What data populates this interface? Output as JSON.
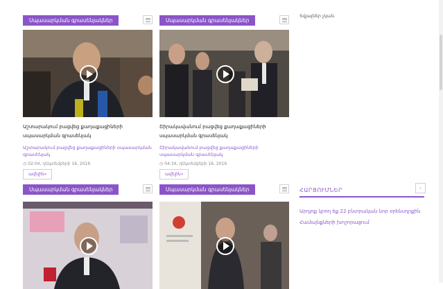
{
  "cards": [
    {
      "category": "Սպասարկման գրասենյակներ",
      "title": "Աշտարակում բացվեց քաղաքացիների սպասարկման գրասենյակ",
      "description": "Աշտարակում բացվեց քաղաքացիների սպասարկման գրասենյակ",
      "time": "02:04",
      "date": "դեկտեմբերի 16, 2016",
      "more": "ավելին"
    },
    {
      "category": "Սպասարկման գրասենյակներ",
      "title": "Շիրակավանում բացվեց քաղաքացիների սպասարկման գրասենյակ",
      "description": "Շիրակավանում բացվեց քաղաքացիների սպասարկման գրասենյակ",
      "time": "04:34",
      "date": "դեկտեմբերի 16, 2016",
      "more": "ավելին"
    },
    {
      "category": "Սպասարկման գրասենյակներ"
    },
    {
      "category": "Սպասարկման գրասենյակներ"
    }
  ],
  "sidebar": {
    "empty_text": "Տվյալներ չկան",
    "announcements_title": "ՀԱՐՑՈՒՄՆԵՐ",
    "announcements": [
      "Արդյոք կրող եք 22 բնտրական նոր օրենսդրքին",
      "Համայնքների խոշորացում"
    ]
  },
  "colors": {
    "accent": "#8b55c8"
  },
  "icons": {
    "menu": "list-icon",
    "play": "play-icon",
    "clock": "clock-icon",
    "arrow": "chevron-right-icon"
  }
}
